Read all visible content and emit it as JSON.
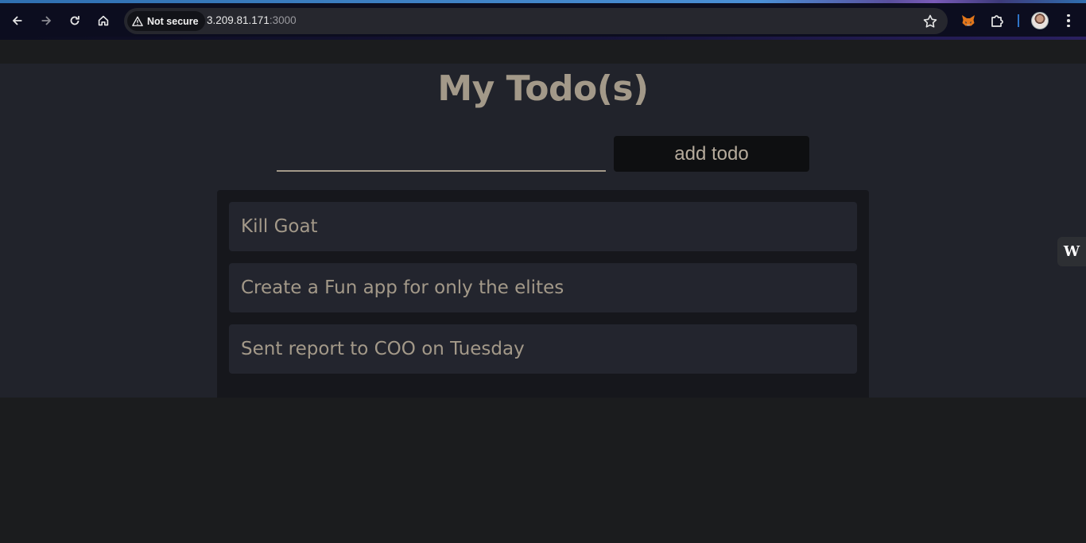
{
  "browser": {
    "security_label": "Not secure",
    "url_host": "3.209.81.171",
    "url_port": ":3000",
    "icons": [
      "back-icon",
      "forward-icon",
      "reload-icon",
      "home-icon",
      "warning-icon",
      "star-icon",
      "metamask-fox-icon",
      "extensions-puzzle-icon",
      "avatar",
      "kebab-menu-icon"
    ]
  },
  "app": {
    "title": "My Todo(s)",
    "input_value": "",
    "add_button_label": "add todo",
    "todos": [
      "Kill Goat",
      "Create a Fun app for only the elites",
      "Sent report to COO on Tuesday"
    ]
  },
  "side_widget": {
    "label": "W"
  },
  "colors": {
    "page_bg": "#21232b",
    "text": "#a39989",
    "item_bg": "#23252e",
    "panel_bg": "#16171c"
  }
}
